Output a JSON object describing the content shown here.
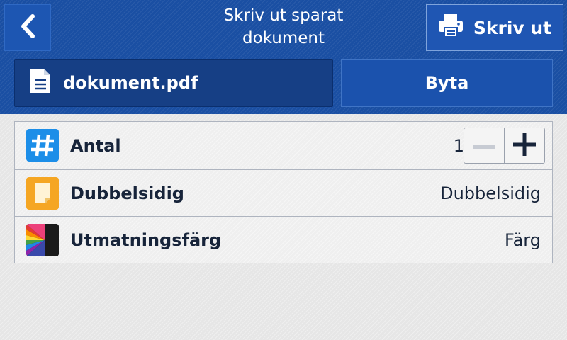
{
  "header": {
    "title_line1": "Skriv ut sparat",
    "title_line2": "dokument",
    "back_icon": "chevron-left-icon",
    "print_button_label": "Skriv ut",
    "print_icon": "printer-icon"
  },
  "document": {
    "file_name": "dokument.pdf",
    "file_icon": "document-icon",
    "change_button_label": "Byta"
  },
  "settings": {
    "quantity": {
      "label": "Antal",
      "value": "1",
      "icon": "hash-icon",
      "decrement_icon": "minus-icon",
      "increment_icon": "plus-icon"
    },
    "duplex": {
      "label": "Dubbelsidig",
      "value": "Dubbelsidig",
      "icon": "page-duplex-icon"
    },
    "output_color": {
      "label": "Utmatningsfärg",
      "value": "Färg",
      "icon": "color-output-icon"
    }
  },
  "colors": {
    "header_blue": "#1a4fa3",
    "quantity_icon": "#1c8ee8",
    "duplex_icon": "#f5a623",
    "text_dark": "#17243a"
  }
}
